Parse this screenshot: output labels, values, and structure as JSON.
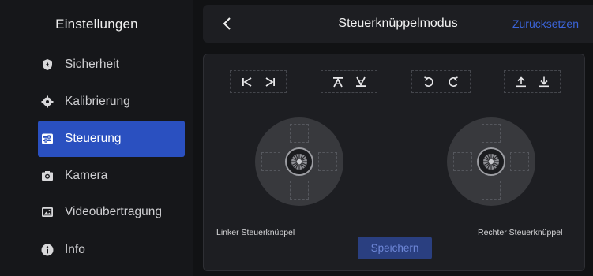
{
  "sidebar": {
    "title": "Einstellungen",
    "items": [
      {
        "label": "Sicherheit",
        "icon": "shield-icon"
      },
      {
        "label": "Kalibrierung",
        "icon": "crosshair-icon"
      },
      {
        "label": "Steuerung",
        "icon": "controller-icon",
        "active": true
      },
      {
        "label": "Kamera",
        "icon": "camera-icon"
      },
      {
        "label": "Videoübertragung",
        "icon": "image-icon"
      },
      {
        "label": "Info",
        "icon": "info-icon"
      }
    ]
  },
  "header": {
    "title": "Steuerknüppelmodus",
    "reset_label": "Zurücksetzen"
  },
  "modes": [
    {
      "icons": [
        "skip-back-icon",
        "skip-forward-icon"
      ]
    },
    {
      "icons": [
        "ascend-icon",
        "descend-icon"
      ]
    },
    {
      "icons": [
        "rotate-ccw-icon",
        "rotate-cw-icon"
      ]
    },
    {
      "icons": [
        "upload-icon",
        "download-icon"
      ]
    }
  ],
  "left_stick_label": "Linker Steuerknüppel",
  "right_stick_label": "Rechter Steuerknüppel",
  "save_label": "Speichern",
  "colors": {
    "accent": "#2a50c0",
    "reset_text": "#3b64d8",
    "save_bg": "#2a3f80"
  }
}
